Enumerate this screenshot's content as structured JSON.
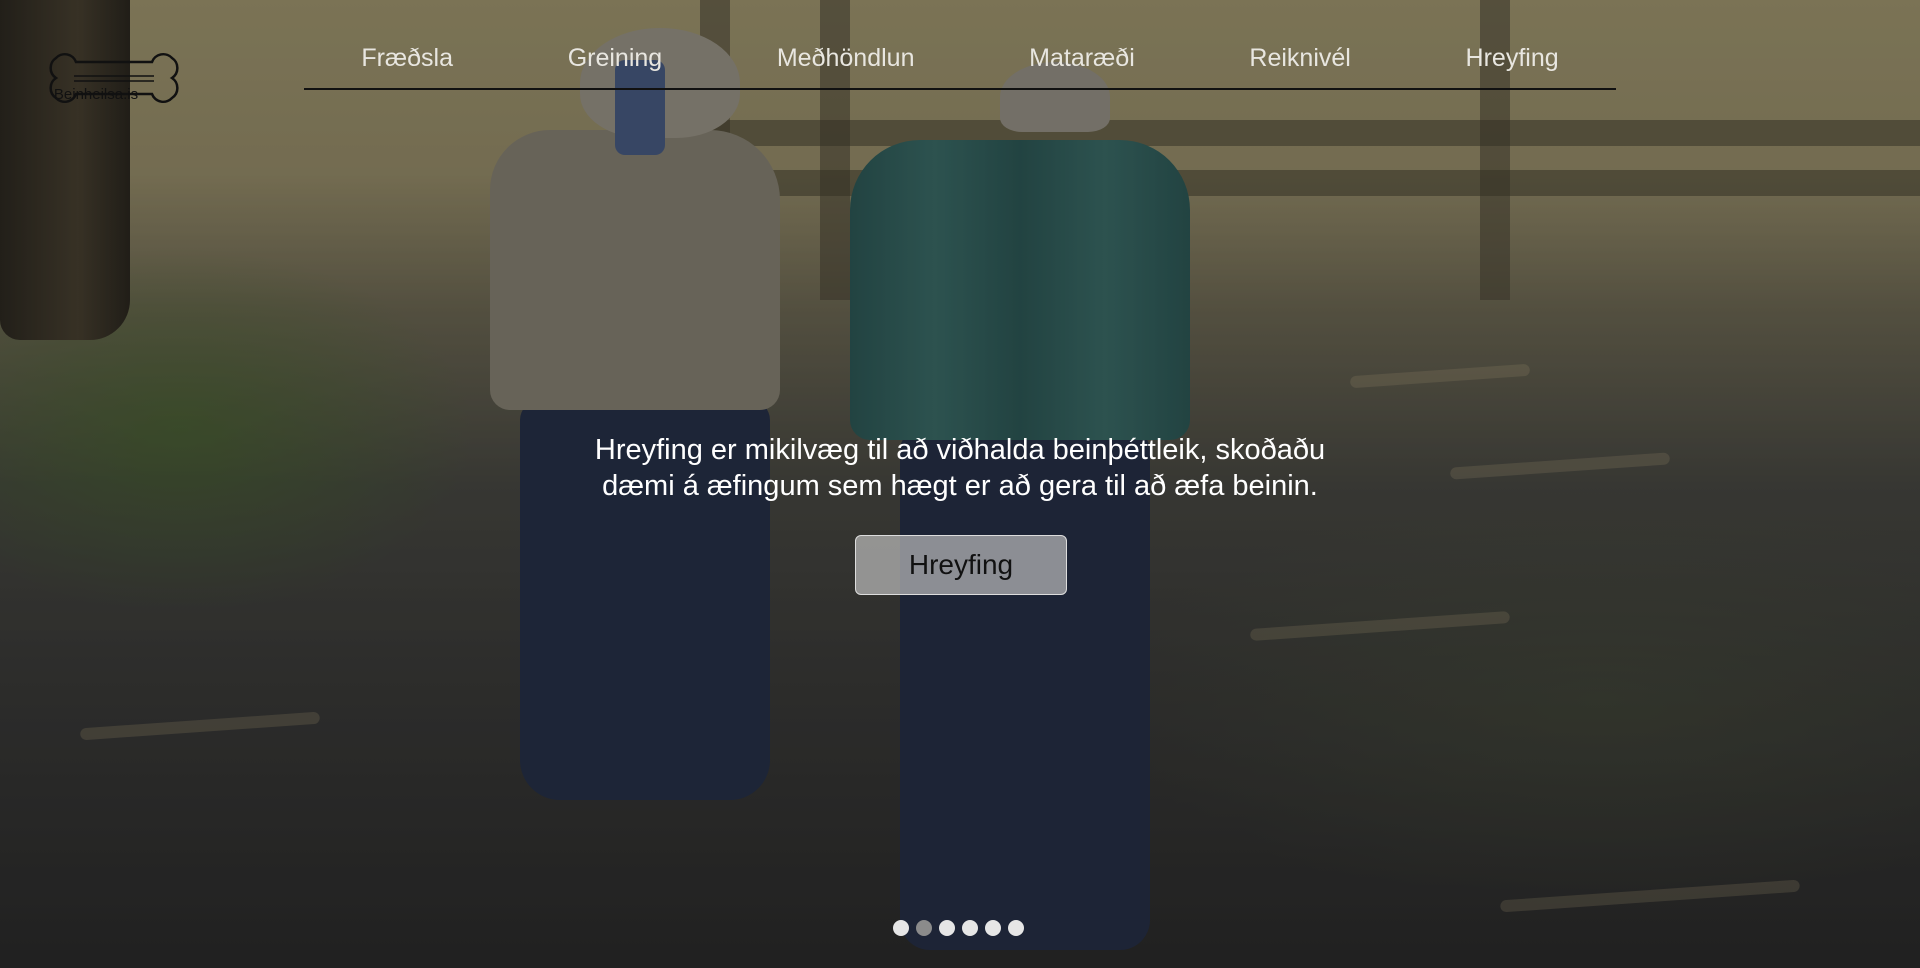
{
  "logo": {
    "text": "Beinheilsa.is"
  },
  "nav": {
    "items": [
      "Fræðsla",
      "Greining",
      "Meðhöndlun",
      "Mataræði",
      "Reiknivél",
      "Hreyfing"
    ]
  },
  "hero": {
    "text": "Hreyfing er mikilvæg til að viðhalda beinþéttleik, skoðaðu dæmi á æfingum sem hægt er að gera til að æfa beinin.",
    "button_label": "Hreyfing"
  },
  "carousel": {
    "slide_count": 6,
    "active_index": 1
  },
  "colors": {
    "nav_text": "#e8e6e0",
    "underline": "#111111",
    "overlay_text": "#ffffff",
    "button_bg": "#c8c8c8"
  }
}
